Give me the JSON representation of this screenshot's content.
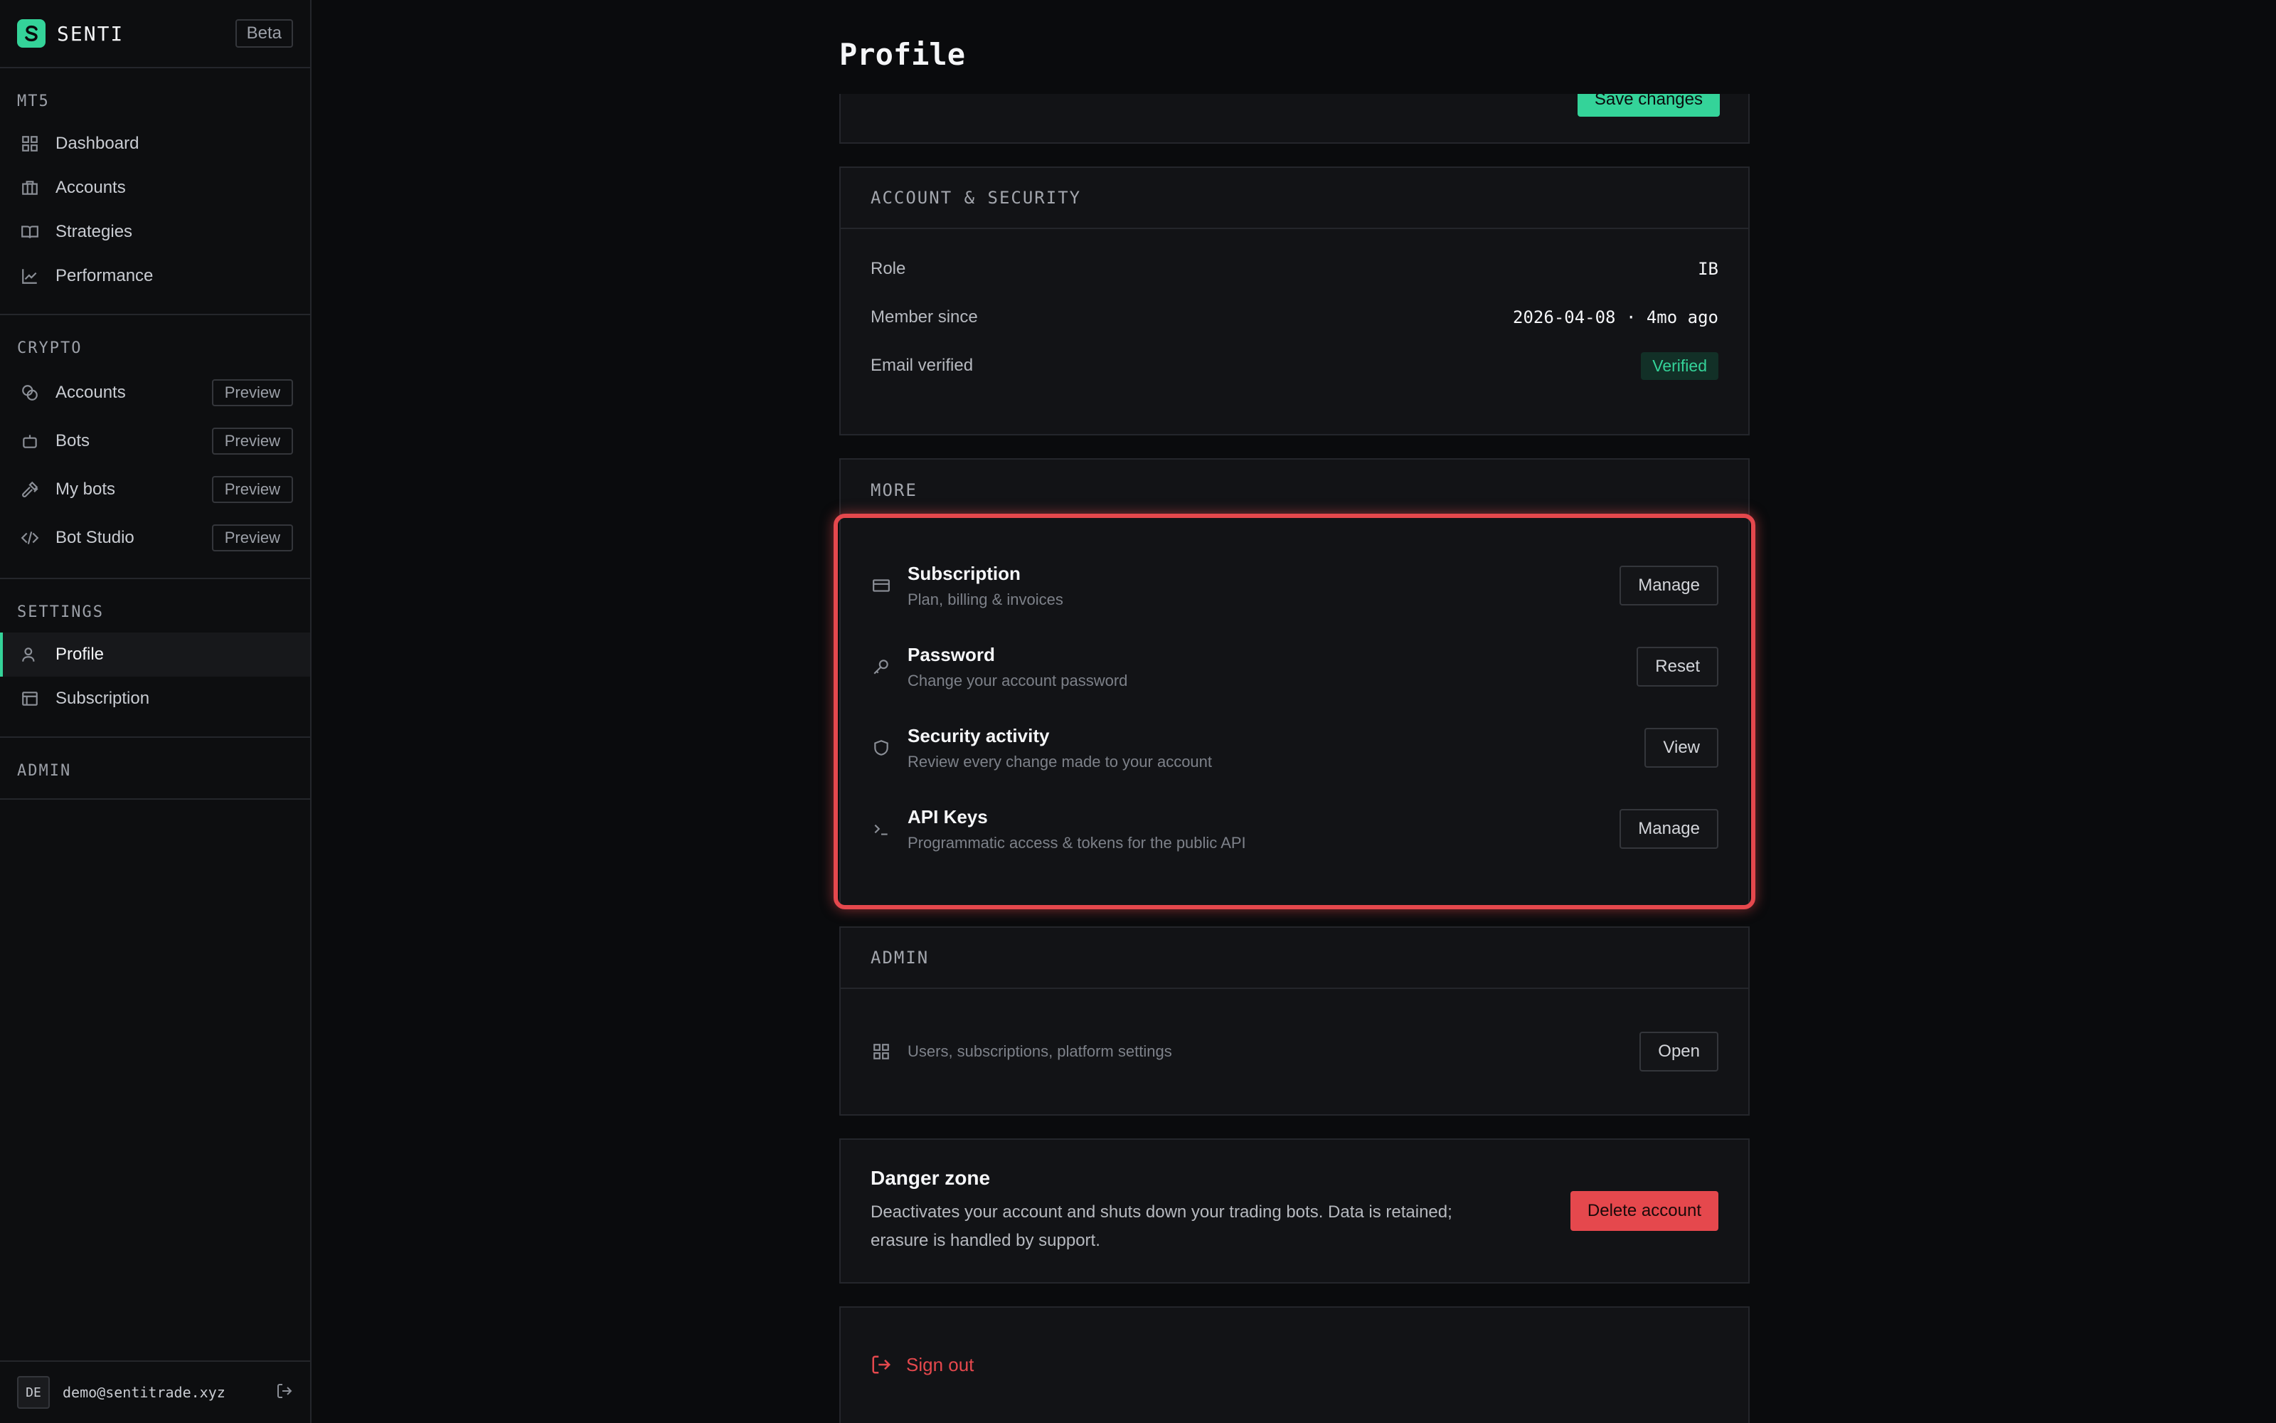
{
  "brand": {
    "name": "SENTI",
    "badge": "Beta"
  },
  "sidebar": {
    "mt5": {
      "title": "MT5",
      "items": [
        {
          "label": "Dashboard",
          "icon": "grid-icon"
        },
        {
          "label": "Accounts",
          "icon": "briefcase-icon"
        },
        {
          "label": "Strategies",
          "icon": "book-icon"
        },
        {
          "label": "Performance",
          "icon": "chart-line-icon"
        }
      ]
    },
    "crypto": {
      "title": "CRYPTO",
      "items": [
        {
          "label": "Accounts",
          "chip": "Preview",
          "icon": "coins-icon"
        },
        {
          "label": "Bots",
          "chip": "Preview",
          "icon": "bot-icon"
        },
        {
          "label": "My bots",
          "chip": "Preview",
          "icon": "hammer-icon"
        },
        {
          "label": "Bot Studio",
          "chip": "Preview",
          "icon": "code-icon"
        }
      ]
    },
    "settings": {
      "title": "SETTINGS",
      "items": [
        {
          "label": "Profile",
          "icon": "user-icon",
          "active": true
        },
        {
          "label": "Subscription",
          "icon": "card-icon"
        }
      ]
    },
    "admin": {
      "title": "ADMIN"
    },
    "user": {
      "initials": "DE",
      "email": "demo@sentitrade.xyz"
    }
  },
  "page": {
    "title": "Profile",
    "save_label": "Save changes"
  },
  "account_security": {
    "title": "ACCOUNT & SECURITY",
    "rows": [
      {
        "label": "Role",
        "value": "IB"
      },
      {
        "label": "Member since",
        "value": "2026-04-08 · 4mo ago"
      },
      {
        "label": "Email verified",
        "value": "Verified"
      }
    ]
  },
  "more": {
    "title": "MORE",
    "items": [
      {
        "title": "Subscription",
        "subtitle": "Plan, billing & invoices",
        "action": "Manage",
        "icon": "credit-card-icon"
      },
      {
        "title": "Password",
        "subtitle": "Change your account password",
        "action": "Reset",
        "icon": "key-icon"
      },
      {
        "title": "Security activity",
        "subtitle": "Review every change made to your account",
        "action": "View",
        "icon": "shield-icon"
      },
      {
        "title": "API Keys",
        "subtitle": "Programmatic access & tokens for the public API",
        "action": "Manage",
        "icon": "terminal-icon"
      }
    ]
  },
  "admin_card": {
    "title": "ADMIN",
    "description": "Users, subscriptions, platform settings",
    "action": "Open"
  },
  "danger": {
    "title": "Danger zone",
    "description": "Deactivates your account and shuts down your trading bots. Data is retained; erasure is handled by support.",
    "action": "Delete account"
  },
  "signout": {
    "label": "Sign out"
  },
  "colors": {
    "accent": "#34d399",
    "danger": "#e5484d",
    "background": "#0a0b0d",
    "card": "#121316"
  }
}
